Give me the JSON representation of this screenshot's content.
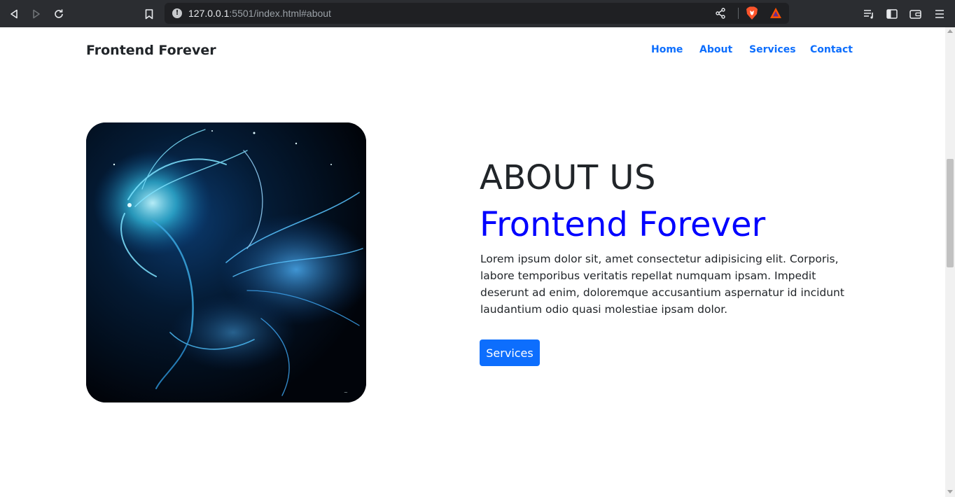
{
  "browser": {
    "url_host": "127.0.0.1",
    "url_rest": ":5501/index.html#about"
  },
  "site": {
    "brand": "Frontend Forever",
    "nav": [
      "Home",
      "About",
      "Services",
      "Contact"
    ]
  },
  "about": {
    "title": "ABOUT US",
    "subtitle": "Frontend Forever",
    "text": "Lorem ipsum dolor sit, amet consectetur adipisicing elit. Corporis, labore temporibus veritatis repellat numquam ipsam. Impedit deserunt ad enim, doloremque accusantium aspernatur id incidunt laudantium odio quasi molestiae ipsam dolor.",
    "button": "Services"
  },
  "colors": {
    "accent": "#0d6efd",
    "subtitle": "#0000ff",
    "text": "#212529"
  }
}
